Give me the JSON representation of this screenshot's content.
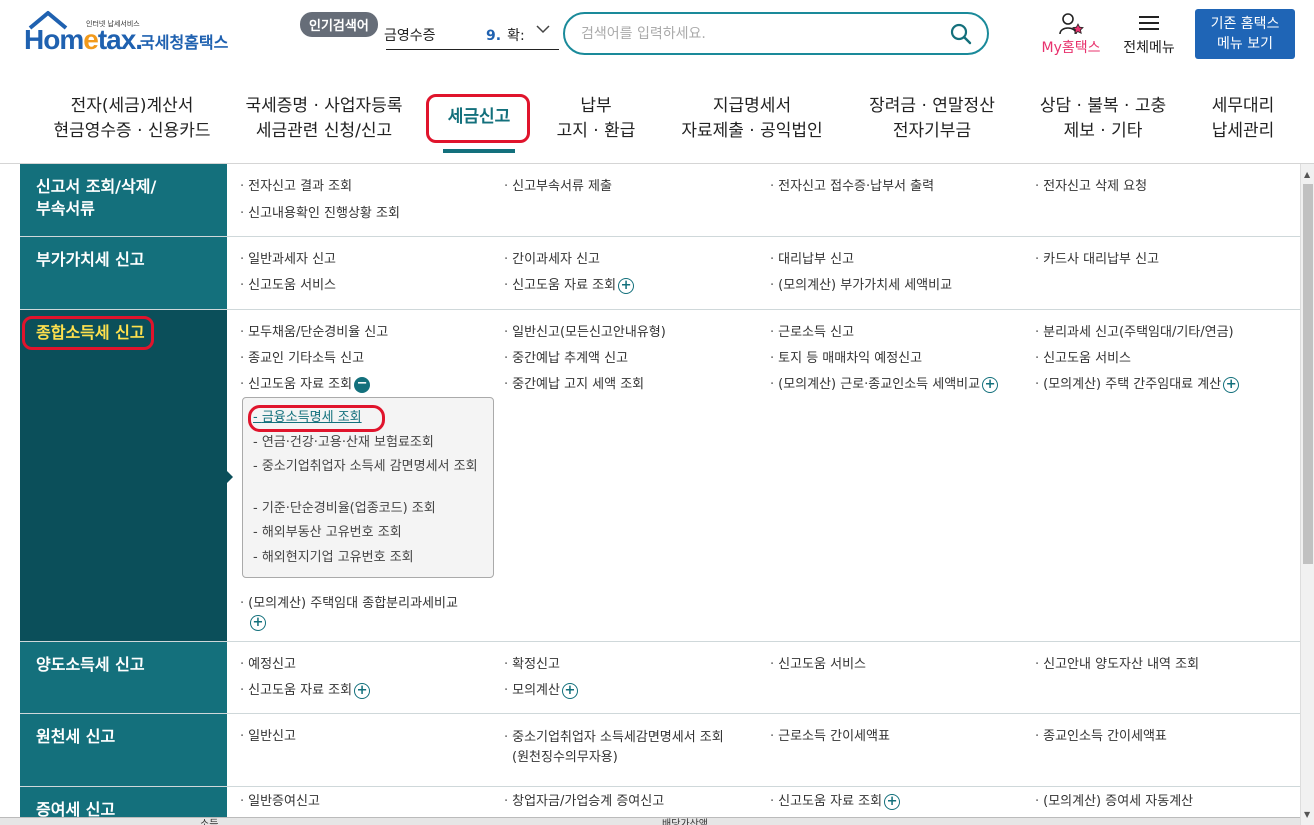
{
  "header": {
    "logo_tiny": "인터넷 납세서비스",
    "logo_text_a": "Hom",
    "logo_text_e": "e",
    "logo_text_b": "tax.",
    "logo_nts": "국세청홈택스",
    "popular_badge": "인기검색어",
    "popular_keyword": "금영수증",
    "popular_rank_num": "9.",
    "popular_rank_text": "확:",
    "search_placeholder": "검색어를 입력하세요.",
    "my_hometax": "My홈택스",
    "all_menu": "전체메뉴",
    "old_hometax_line1": "기존 홈택스",
    "old_hometax_line2": "메뉴 보기"
  },
  "gnb": [
    {
      "l1": "전자(세금)계산서",
      "l2": "현금영수증 · 신용카드"
    },
    {
      "l1": "국세증명 · 사업자등록",
      "l2": "세금관련 신청/신고"
    },
    {
      "l1": "세금신고",
      "l2": ""
    },
    {
      "l1": "납부",
      "l2": "고지 · 환급"
    },
    {
      "l1": "지급명세서",
      "l2": "자료제출 · 공익법인"
    },
    {
      "l1": "장려금 · 연말정산",
      "l2": "전자기부금"
    },
    {
      "l1": "상담 · 불복 · 고충",
      "l2": "제보 · 기타"
    },
    {
      "l1": "세무대리",
      "l2": "납세관리"
    }
  ],
  "sections": [
    {
      "cat": "신고서 조회/삭제/부속서류",
      "items": [
        "전자신고 결과 조회",
        "신고부속서류 제출",
        "전자신고 접수증·납부서 출력",
        "전자신고 삭제 요청",
        "신고내용확인 진행상황 조회"
      ]
    },
    {
      "cat": "부가가치세 신고",
      "items": [
        "일반과세자 신고",
        "간이과세자 신고",
        "대리납부 신고",
        "카드사 대리납부 신고",
        "신고도움 서비스",
        "신고도움 자료 조회",
        "(모의계산) 부가가치세 세액비교"
      ]
    },
    {
      "cat": "종합소득세 신고",
      "items": [
        "모두채움/단순경비율 신고",
        "일반신고(모든신고안내유형)",
        "근로소득 신고",
        "분리과세 신고(주택임대/기타/연금)",
        "종교인 기타소득 신고",
        "중간예납 추계액 신고",
        "토지 등 매매차익 예정신고",
        "신고도움 서비스",
        "신고도움 자료 조회",
        "중간예납 고지 세액 조회",
        "(모의계산) 근로·종교인소득 세액비교",
        "(모의계산) 주택 간주임대료 계산",
        "(모의계산) 주택임대 종합분리과세비교"
      ],
      "sub": [
        "금융소득명세 조회",
        "연금·건강·고용·산재 보험료조회",
        "중소기업취업자 소득세 감면명세서 조회",
        "기준·단순경비율(업종코드) 조회",
        "해외부동산 고유번호 조회",
        "해외현지기업 고유번호 조회"
      ]
    },
    {
      "cat": "양도소득세 신고",
      "items": [
        "예정신고",
        "확정신고",
        "신고도움 서비스",
        "신고안내 양도자산 내역 조회",
        "신고도움 자료 조회",
        "모의계산"
      ]
    },
    {
      "cat": "원천세 신고",
      "items": [
        "일반신고",
        "중소기업취업자 소득세감면명세서 조회",
        "(원천징수의무자용)",
        "근로소득 간이세액표",
        "종교인소득 간이세액표"
      ]
    },
    {
      "cat": "증여세 신고",
      "items": [
        "일반증여신고",
        "창업자금/가업승계 증여신고",
        "신고도움 자료 조회",
        "(모의계산) 증여세 자동계산"
      ]
    }
  ],
  "bottom": {
    "left": "소득",
    "mid": "배당가산액"
  },
  "colors": {
    "teal": "#14707c",
    "dark_teal": "#0b4f5a",
    "brand_blue": "#1f61b0",
    "highlight_red": "#e0142c",
    "my_pink": "#e8336e"
  }
}
